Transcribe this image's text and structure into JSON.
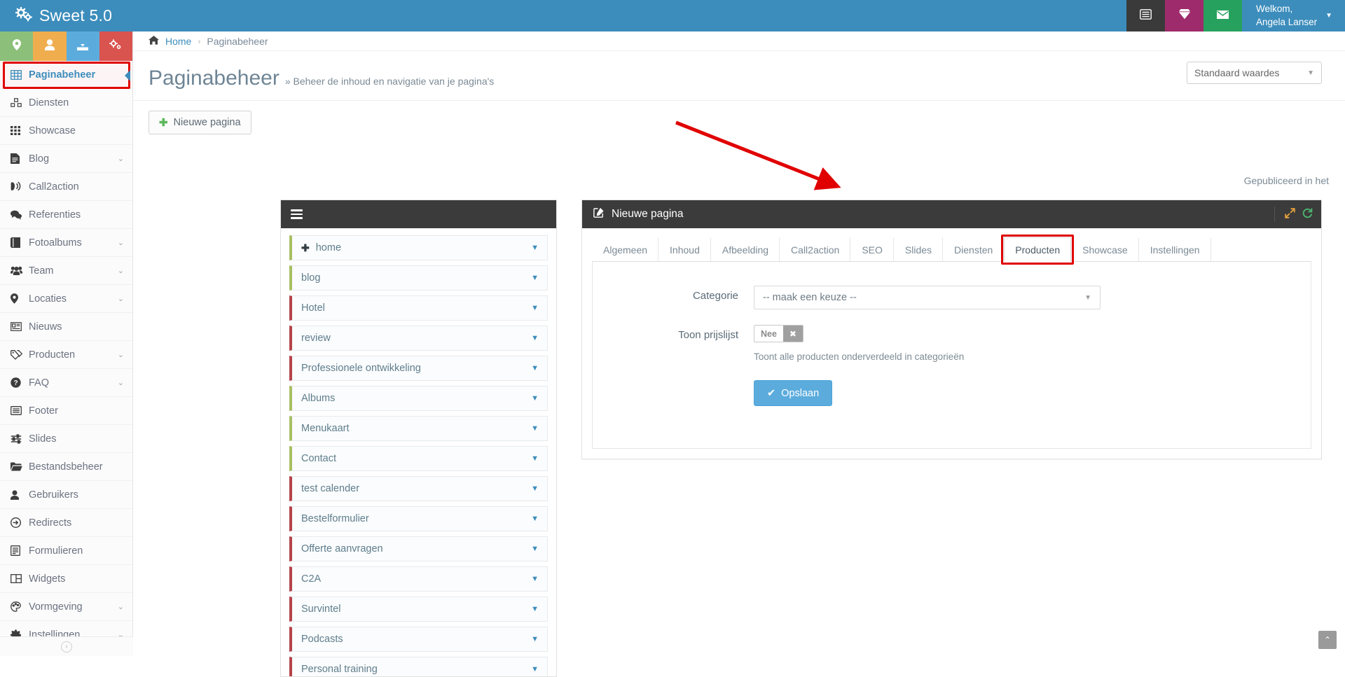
{
  "topbar": {
    "brand": "Sweet 5.0",
    "brand_icon": "gears-icon",
    "buttons": [
      {
        "name": "list-button",
        "icon": "list-alt-icon",
        "color": "#3a3a3a"
      },
      {
        "name": "awards-button",
        "icon": "diamond-icon",
        "color": "#9e2b6b"
      },
      {
        "name": "mail-button",
        "icon": "envelope-icon",
        "color": "#27a15e"
      }
    ],
    "user": {
      "greeting": "Welkom,",
      "name": "Angela Lanser"
    }
  },
  "sidebar": {
    "quick_actions": [
      {
        "name": "location-action",
        "icon": "map-marker-icon",
        "color": "#8cc07a"
      },
      {
        "name": "user-action",
        "icon": "user-icon",
        "color": "#f0ad4e"
      },
      {
        "name": "download-action",
        "icon": "download-icon",
        "color": "#5bacdd"
      },
      {
        "name": "settings-action",
        "icon": "gears-icon",
        "color": "#d9534f"
      }
    ],
    "items": [
      {
        "label": "Paginabeheer",
        "icon": "table-icon",
        "caret": false,
        "active": true
      },
      {
        "label": "Diensten",
        "icon": "cubes-icon",
        "caret": false,
        "active": false
      },
      {
        "label": "Showcase",
        "icon": "th-icon",
        "caret": false,
        "active": false
      },
      {
        "label": "Blog",
        "icon": "file-text-icon",
        "caret": true,
        "active": false
      },
      {
        "label": "Call2action",
        "icon": "phone-volume-icon",
        "caret": false,
        "active": false
      },
      {
        "label": "Referenties",
        "icon": "comments-icon",
        "caret": false,
        "active": false
      },
      {
        "label": "Fotoalbums",
        "icon": "book-icon",
        "caret": true,
        "active": false
      },
      {
        "label": "Team",
        "icon": "users-icon",
        "caret": true,
        "active": false
      },
      {
        "label": "Locaties",
        "icon": "map-marker-icon",
        "caret": true,
        "active": false
      },
      {
        "label": "Nieuws",
        "icon": "newspaper-icon",
        "caret": false,
        "active": false
      },
      {
        "label": "Producten",
        "icon": "tags-icon",
        "caret": true,
        "active": false
      },
      {
        "label": "FAQ",
        "icon": "question-icon",
        "caret": true,
        "active": false
      },
      {
        "label": "Footer",
        "icon": "list-alt-icon",
        "caret": false,
        "active": false
      },
      {
        "label": "Slides",
        "icon": "sliders-icon",
        "caret": false,
        "active": false
      },
      {
        "label": "Bestandsbeheer",
        "icon": "folder-open-icon",
        "caret": false,
        "active": false
      },
      {
        "label": "Gebruikers",
        "icon": "user-icon",
        "caret": false,
        "active": false
      },
      {
        "label": "Redirects",
        "icon": "arrow-circle-icon",
        "caret": false,
        "active": false
      },
      {
        "label": "Formulieren",
        "icon": "wpforms-icon",
        "caret": false,
        "active": false
      },
      {
        "label": "Widgets",
        "icon": "columns-icon",
        "caret": false,
        "active": false
      },
      {
        "label": "Vormgeving",
        "icon": "palette-icon",
        "caret": true,
        "active": false
      },
      {
        "label": "Instellingen",
        "icon": "cog-icon",
        "caret": true,
        "active": false
      }
    ],
    "footer_icon": "collapse-icon"
  },
  "breadcrumb": {
    "home_icon": "home-icon",
    "items": [
      "Home",
      "Paginabeheer"
    ],
    "separator": "›"
  },
  "page": {
    "title": "Paginabeheer",
    "subtitle": "» Beheer de inhoud en navigatie van je pagina's",
    "default_select": "Standaard waardes",
    "new_page_button": "Nieuwe pagina",
    "published_note": "Gepubliceerd in het"
  },
  "page_list": {
    "menu_icon": "hamburger-icon",
    "items": [
      {
        "label": "home",
        "color": "#a8bf63",
        "plus": true
      },
      {
        "label": "blog",
        "color": "#a8bf63",
        "plus": false
      },
      {
        "label": "Hotel",
        "color": "#b5434a",
        "plus": false
      },
      {
        "label": "review",
        "color": "#b5434a",
        "plus": false
      },
      {
        "label": "Professionele ontwikkeling",
        "color": "#b5434a",
        "plus": false
      },
      {
        "label": "Albums",
        "color": "#a8bf63",
        "plus": false
      },
      {
        "label": "Menukaart",
        "color": "#a8bf63",
        "plus": false
      },
      {
        "label": "Contact",
        "color": "#a8bf63",
        "plus": false
      },
      {
        "label": "test calender",
        "color": "#b5434a",
        "plus": false
      },
      {
        "label": "Bestelformulier",
        "color": "#b5434a",
        "plus": false
      },
      {
        "label": "Offerte aanvragen",
        "color": "#b5434a",
        "plus": false
      },
      {
        "label": "C2A",
        "color": "#b5434a",
        "plus": false
      },
      {
        "label": "Survintel",
        "color": "#b5434a",
        "plus": false
      },
      {
        "label": "Podcasts",
        "color": "#b5434a",
        "plus": false
      },
      {
        "label": "Personal training",
        "color": "#b5434a",
        "plus": false
      }
    ]
  },
  "editor": {
    "header_icon": "edit-icon",
    "header_title": "Nieuwe pagina",
    "tools": [
      {
        "name": "expand-icon",
        "glyph": "⤡",
        "color": "#e8a33d"
      },
      {
        "name": "refresh-icon",
        "glyph": "⟳",
        "color": "#4bb56f"
      }
    ],
    "tabs": [
      {
        "label": "Algemeen",
        "active": false
      },
      {
        "label": "Inhoud",
        "active": false
      },
      {
        "label": "Afbeelding",
        "active": false
      },
      {
        "label": "Call2action",
        "active": false
      },
      {
        "label": "SEO",
        "active": false
      },
      {
        "label": "Slides",
        "active": false
      },
      {
        "label": "Diensten",
        "active": false
      },
      {
        "label": "Producten",
        "active": true
      },
      {
        "label": "Showcase",
        "active": false
      },
      {
        "label": "Instellingen",
        "active": false
      }
    ],
    "form": {
      "categorie_label": "Categorie",
      "categorie_value": "-- maak een keuze --",
      "prijslijst_label": "Toon prijslijst",
      "prijslijst_value": "Nee",
      "prijslijst_knob_icon": "close-icon",
      "help_text": "Toont alle producten onderverdeeld in categorieën",
      "save_button": "Opslaan",
      "save_icon": "check-icon"
    }
  },
  "annotations": {
    "arrow_color": "#e00000",
    "highlight_color": "#e00000"
  },
  "scroll_top": {
    "icon": "chevron-up-icon"
  }
}
